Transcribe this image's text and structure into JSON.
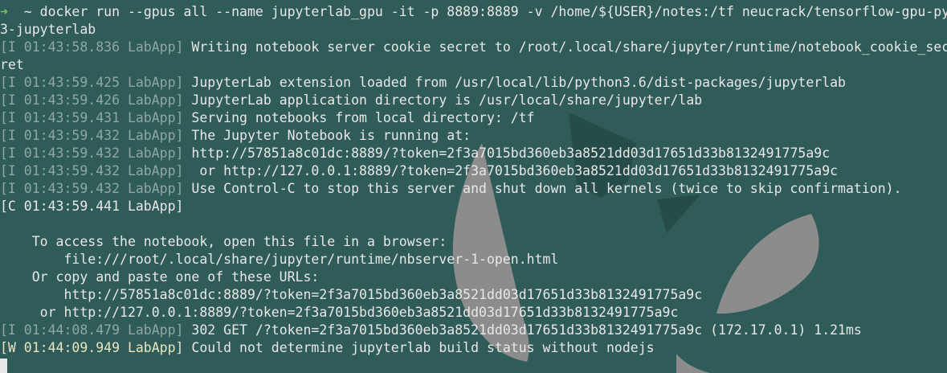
{
  "terminal": {
    "command_line": {
      "arrow": "➜",
      "text": "  ~ docker run --gpus all --name jupyterlab_gpu -it -p 8889:8889 -v /home/${USER}/notes:/tf neucrack/tensorflow-gpu-py"
    },
    "command_cont": "3-jupyterlab",
    "log": [
      {
        "prefix": "[I 01:43:58.836 LabApp]",
        "message": " Writing notebook server cookie secret to /root/.local/share/jupyter/runtime/notebook_cookie_sec"
      },
      {
        "prefix": "",
        "message": "ret"
      },
      {
        "prefix": "[I 01:43:59.425 LabApp]",
        "message": " JupyterLab extension loaded from /usr/local/lib/python3.6/dist-packages/jupyterlab"
      },
      {
        "prefix": "[I 01:43:59.426 LabApp]",
        "message": " JupyterLab application directory is /usr/local/share/jupyter/lab"
      },
      {
        "prefix": "[I 01:43:59.431 LabApp]",
        "message": " Serving notebooks from local directory: /tf"
      },
      {
        "prefix": "[I 01:43:59.432 LabApp]",
        "message": " The Jupyter Notebook is running at:"
      },
      {
        "prefix": "[I 01:43:59.432 LabApp]",
        "message": " http://57851a8c01dc:8889/?token=2f3a7015bd360eb3a8521dd03d17651d33b8132491775a9c"
      },
      {
        "prefix": "[I 01:43:59.432 LabApp]",
        "message": "  or http://127.0.0.1:8889/?token=2f3a7015bd360eb3a8521dd03d17651d33b8132491775a9c"
      },
      {
        "prefix": "[I 01:43:59.432 LabApp]",
        "message": " Use Control-C to stop this server and shut down all kernels (twice to skip confirmation)."
      },
      {
        "prefix": "[C 01:43:59.441 LabApp]",
        "message": ""
      },
      {
        "prefix": "",
        "message": ""
      },
      {
        "prefix": "",
        "message": "    To access the notebook, open this file in a browser:"
      },
      {
        "prefix": "",
        "message": "        file:///root/.local/share/jupyter/runtime/nbserver-1-open.html"
      },
      {
        "prefix": "",
        "message": "    Or copy and paste one of these URLs:"
      },
      {
        "prefix": "",
        "message": "        http://57851a8c01dc:8889/?token=2f3a7015bd360eb3a8521dd03d17651d33b8132491775a9c"
      },
      {
        "prefix": "",
        "message": "     or http://127.0.0.1:8889/?token=2f3a7015bd360eb3a8521dd03d17651d33b8132491775a9c"
      },
      {
        "prefix": "[I 01:44:08.479 LabApp]",
        "message": " 302 GET /?token=2f3a7015bd360eb3a8521dd03d17651d33b8132491775a9c (172.17.0.1) 1.21ms"
      },
      {
        "prefix": "[W 01:44:09.949 LabApp]",
        "message": " Could not determine jupyterlab build status without nodejs"
      }
    ]
  },
  "colors": {
    "background": "#2f5b58",
    "text": "#e8e8e8",
    "dim": "#8fa8a6",
    "prompt_arrow": "#7fbf6a",
    "warning": "#e8e6c2",
    "wallpaper_shape": "#8c8c8c"
  }
}
